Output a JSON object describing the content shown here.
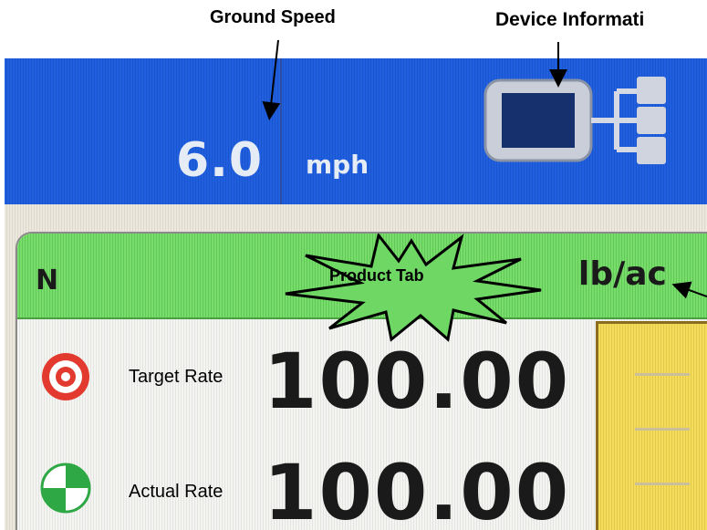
{
  "annotations": {
    "ground_speed": "Ground Speed",
    "device_information": "Device Informati",
    "product_tab": "Product Tab"
  },
  "top_bar": {
    "speed_value": "6.0",
    "speed_unit": "mph",
    "device_icon": "device-information-icon"
  },
  "product": {
    "name": "N",
    "unit": "lb/ac"
  },
  "rates": {
    "target_label": "Target Rate",
    "target_value": "100.00",
    "target_icon": "target-icon",
    "actual_label": "Actual Rate",
    "actual_value": "100.00",
    "actual_icon": "actual-rate-icon"
  },
  "colors": {
    "top_bar": "#1f5fe0",
    "product_tab": "#79dd6c",
    "gauge": "#f4dd5a",
    "target_red": "#e23a2e",
    "actual_green": "#2ea844"
  }
}
